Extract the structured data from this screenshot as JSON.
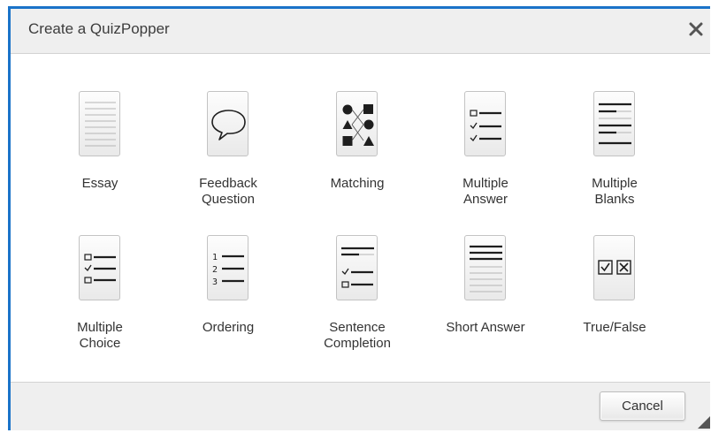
{
  "dialog": {
    "title": "Create a QuizPopper",
    "close_icon": "close-icon"
  },
  "tiles": [
    {
      "label": "Essay",
      "icon": "essay-icon"
    },
    {
      "label": "Feedback\nQuestion",
      "icon": "speech-bubble-icon"
    },
    {
      "label": "Matching",
      "icon": "matching-icon"
    },
    {
      "label": "Multiple\nAnswer",
      "icon": "multiple-answer-icon"
    },
    {
      "label": "Multiple\nBlanks",
      "icon": "multiple-blanks-icon"
    },
    {
      "label": "Multiple\nChoice",
      "icon": "multiple-choice-icon"
    },
    {
      "label": "Ordering",
      "icon": "ordering-icon"
    },
    {
      "label": "Sentence\nCompletion",
      "icon": "sentence-completion-icon"
    },
    {
      "label": "Short Answer",
      "icon": "short-answer-icon"
    },
    {
      "label": "True/False",
      "icon": "true-false-icon"
    }
  ],
  "icon_glyphs": {
    "ordering_numbers": [
      "1",
      "2",
      "3"
    ]
  },
  "footer": {
    "cancel_label": "Cancel"
  },
  "colors": {
    "accent_border": "#1a73c9",
    "titlebar_bg": "#efefef",
    "icon_ink": "#1e1e1e"
  }
}
